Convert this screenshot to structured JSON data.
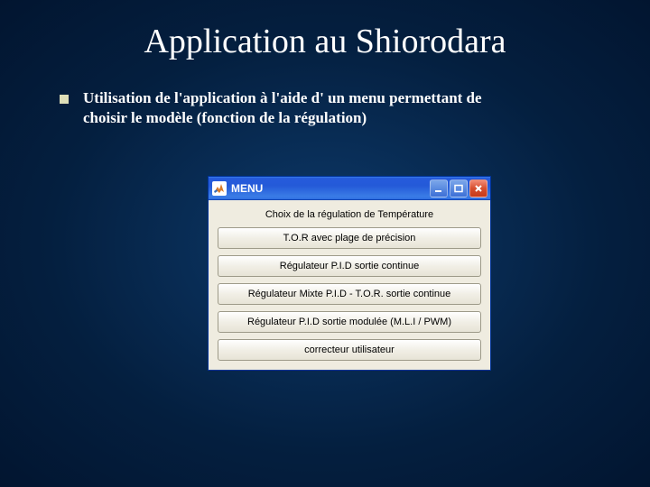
{
  "slide": {
    "title": "Application au Shiorodara",
    "bullet": "Utilisation de l'application à l'aide d' un menu permettant de choisir le modèle (fonction de la régulation)"
  },
  "window": {
    "title": "MENU",
    "heading": "Choix de la régulation de Température",
    "options": [
      "T.O.R avec plage de précision",
      "Régulateur P.I.D sortie continue",
      "Régulateur Mixte P.I.D - T.O.R. sortie continue",
      "Régulateur P.I.D sortie modulée (M.L.I / PWM)",
      "correcteur utilisateur"
    ]
  }
}
